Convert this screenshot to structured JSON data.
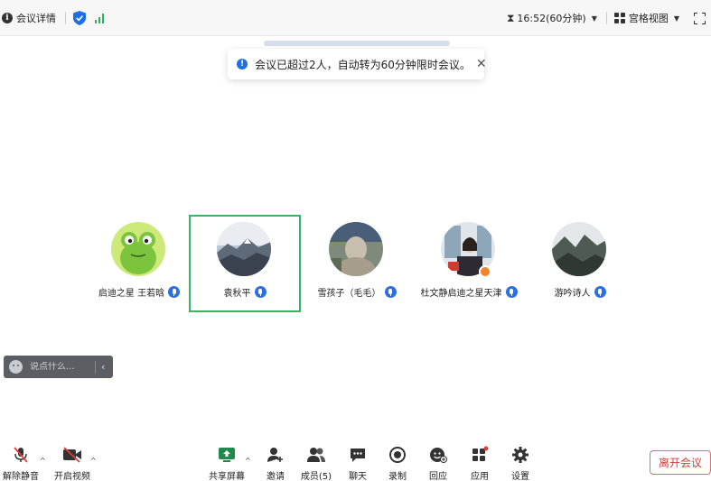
{
  "topbar": {
    "meeting_details": "会议详情",
    "time_text": "16:52(60分钟)",
    "view_label": "宫格视图"
  },
  "toast": {
    "message": "会议已超过2人，自动转为60分钟限时会议。"
  },
  "participants": [
    {
      "name": "启迪之星   王若晗",
      "active": false
    },
    {
      "name": "袁秋平",
      "active": true
    },
    {
      "name": "雪孩子（毛毛）",
      "active": false
    },
    {
      "name": "杜文静启迪之星天津",
      "active": false
    },
    {
      "name": "游吟诗人",
      "active": false
    }
  ],
  "chat": {
    "placeholder": "说点什么..."
  },
  "toolbar": {
    "unmute": "解除静音",
    "start_video": "开启视频",
    "share_screen": "共享屏幕",
    "invite": "邀请",
    "members": "成员(5)",
    "chat": "聊天",
    "record": "录制",
    "reactions": "回应",
    "apps": "应用",
    "settings": "设置",
    "leave": "离开会议"
  },
  "colors": {
    "active_border": "#37b565",
    "mic_badge": "#2b6fe0",
    "leave": "#d83a3a",
    "signal": "#2fb05b"
  }
}
